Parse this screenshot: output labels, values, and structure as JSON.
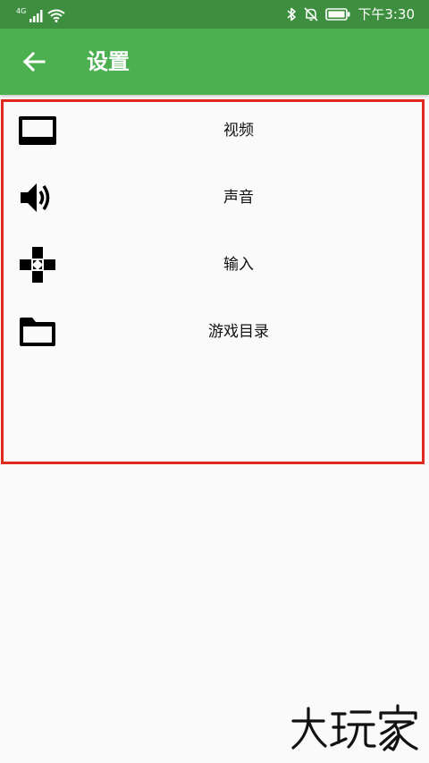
{
  "status_bar": {
    "network_type": "4G",
    "time": "下午3:30",
    "icons": [
      "signal-icon",
      "wifi-icon",
      "bluetooth-icon",
      "mute-icon",
      "battery-icon"
    ]
  },
  "app_bar": {
    "back_icon": "arrow-left-icon",
    "title": "设置"
  },
  "settings_menu": {
    "items": [
      {
        "icon": "display-icon",
        "label": "视频"
      },
      {
        "icon": "speaker-icon",
        "label": "声音"
      },
      {
        "icon": "gamepad-icon",
        "label": "输入"
      },
      {
        "icon": "folder-icon",
        "label": "游戏目录"
      }
    ]
  },
  "watermark": {
    "text": "大玩家"
  },
  "colors": {
    "status_bar": "#3d8f3f",
    "app_bar": "#4caf50",
    "highlight_border": "#e12a1c",
    "background": "#fafafa"
  }
}
